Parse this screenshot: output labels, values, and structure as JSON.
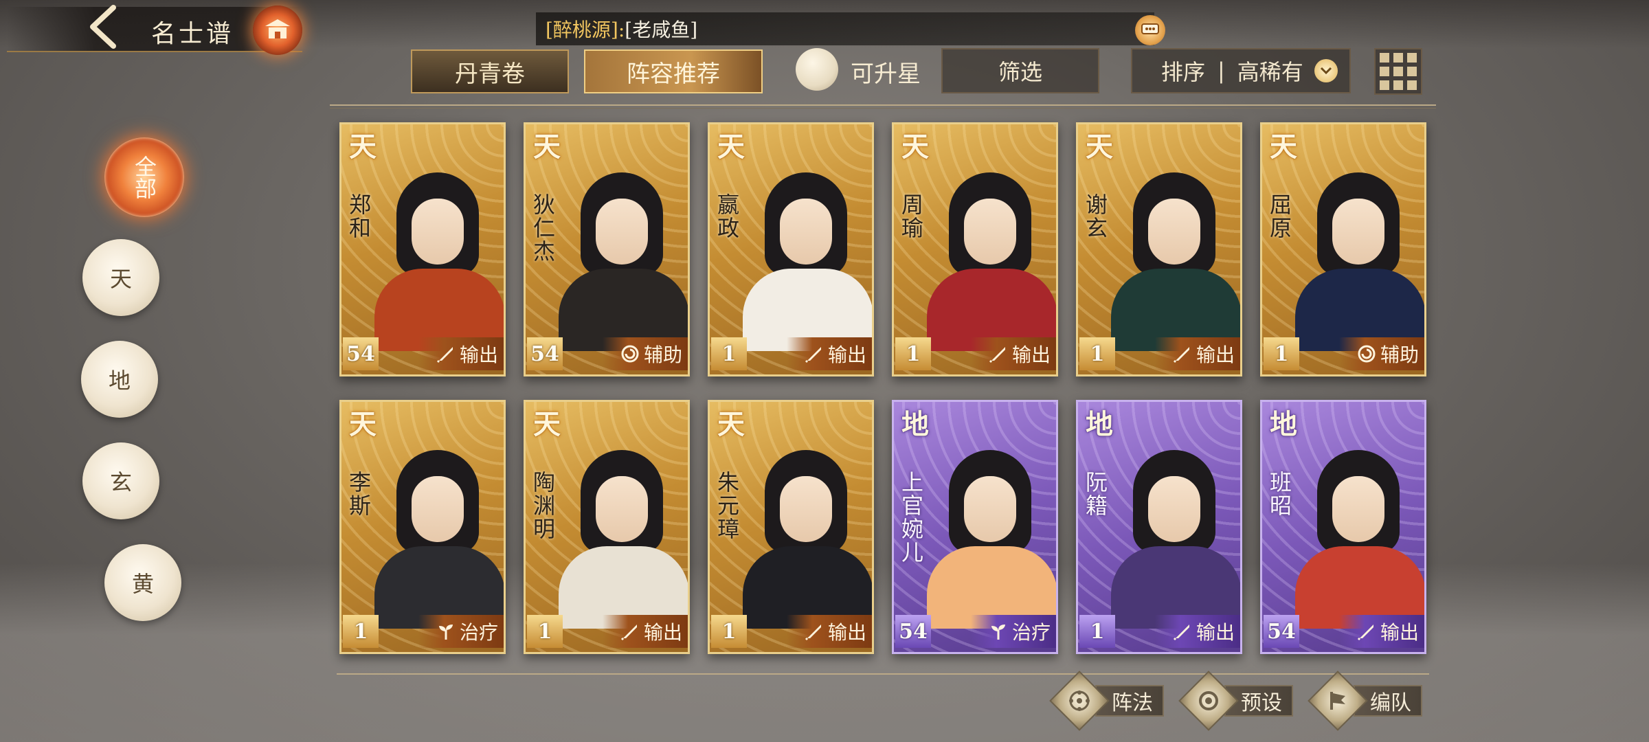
{
  "header": {
    "title": "名士谱"
  },
  "chat": {
    "channel": "[醉桃源]:",
    "message": "[老咸鱼]"
  },
  "tabs": [
    {
      "label": "丹青卷",
      "active": false
    },
    {
      "label": "阵容推荐",
      "active": true
    }
  ],
  "toolbar": {
    "star_up_label": "可升星",
    "filter_label": "筛选",
    "sort_label": "排序",
    "sort_separator": "|",
    "sort_value": "高稀有"
  },
  "rarity_filters": [
    {
      "label": "全部",
      "active": true
    },
    {
      "label": "天",
      "active": false
    },
    {
      "label": "地",
      "active": false
    },
    {
      "label": "玄",
      "active": false
    },
    {
      "label": "黄",
      "active": false
    }
  ],
  "cards": [
    {
      "rarity": "天",
      "name": "郑和",
      "level": "54",
      "role": "输出",
      "role_icon": "brush-icon",
      "robe_color": "#b8431f"
    },
    {
      "rarity": "天",
      "name": "狄仁杰",
      "level": "54",
      "role": "辅助",
      "role_icon": "swirl-icon",
      "robe_color": "#2a2624"
    },
    {
      "rarity": "天",
      "name": "嬴政",
      "level": "1",
      "role": "输出",
      "role_icon": "brush-icon",
      "robe_color": "#f2ede4"
    },
    {
      "rarity": "天",
      "name": "周瑜",
      "level": "1",
      "role": "输出",
      "role_icon": "brush-icon",
      "robe_color": "#a8272b"
    },
    {
      "rarity": "天",
      "name": "谢玄",
      "level": "1",
      "role": "输出",
      "role_icon": "brush-icon",
      "robe_color": "#1f3b36"
    },
    {
      "rarity": "天",
      "name": "屈原",
      "level": "1",
      "role": "辅助",
      "role_icon": "swirl-icon",
      "robe_color": "#1d2748"
    },
    {
      "rarity": "天",
      "name": "李斯",
      "level": "1",
      "role": "治疗",
      "role_icon": "sprout-icon",
      "robe_color": "#2c2c30"
    },
    {
      "rarity": "天",
      "name": "陶渊明",
      "level": "1",
      "role": "输出",
      "role_icon": "brush-icon",
      "robe_color": "#e8e1d3"
    },
    {
      "rarity": "天",
      "name": "朱元璋",
      "level": "1",
      "role": "输出",
      "role_icon": "brush-icon",
      "robe_color": "#1f1f24"
    },
    {
      "rarity": "地",
      "name": "上官婉儿",
      "level": "54",
      "role": "治疗",
      "role_icon": "sprout-icon",
      "robe_color": "#f2b47a"
    },
    {
      "rarity": "地",
      "name": "阮籍",
      "level": "1",
      "role": "输出",
      "role_icon": "brush-icon",
      "robe_color": "#4a3775"
    },
    {
      "rarity": "地",
      "name": "班昭",
      "level": "54",
      "role": "输出",
      "role_icon": "brush-icon",
      "robe_color": "#c84030"
    }
  ],
  "actions": [
    {
      "label": "阵法",
      "icon": "formation-icon"
    },
    {
      "label": "预设",
      "icon": "eye-icon"
    },
    {
      "label": "编队",
      "icon": "banner-icon"
    }
  ],
  "colors": {
    "tian_gold": "#c48c32",
    "di_purple": "#7b58b8",
    "active_orange": "#f0813c"
  }
}
